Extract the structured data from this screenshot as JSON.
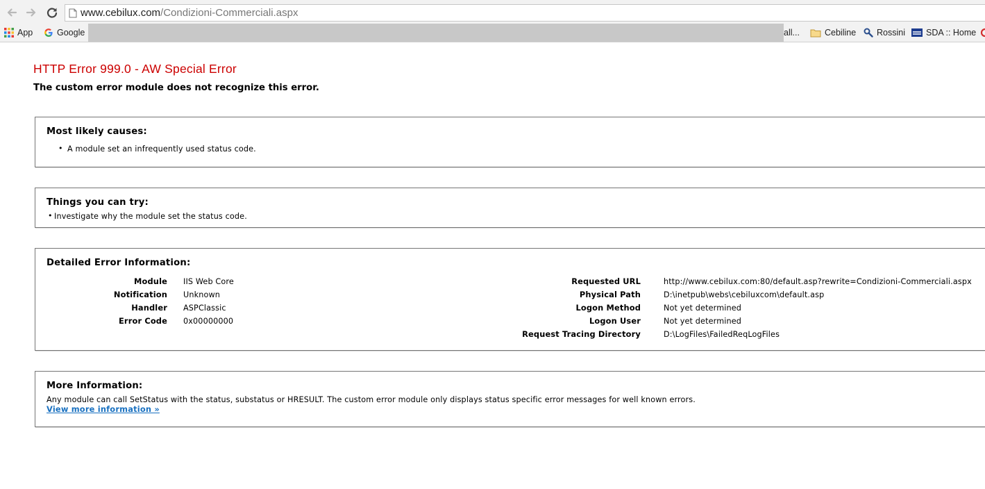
{
  "browser": {
    "url_host": "www.cebilux.com",
    "url_path": "/Condizioni-Commerciali.aspx",
    "bookmarks": [
      {
        "label": "App",
        "icon": "apps-grid-icon"
      },
      {
        "label": "Google",
        "icon": "google-icon"
      },
      {
        "label": "all...",
        "icon": ""
      },
      {
        "label": "Cebiline",
        "icon": "folder-icon"
      },
      {
        "label": "Rossini",
        "icon": "rossini-icon"
      },
      {
        "label": "SDA :: Home",
        "icon": "sda-icon"
      }
    ]
  },
  "error": {
    "title": "HTTP Error 999.0 - AW Special Error",
    "subtitle": "The custom error module does not recognize this error.",
    "causes": {
      "heading": "Most likely causes:",
      "items": [
        "A module set an infrequently used status code."
      ]
    },
    "try": {
      "heading": "Things you can try:",
      "items": [
        "Investigate why the module set the status code."
      ]
    },
    "detail": {
      "heading": "Detailed Error Information:",
      "left": [
        {
          "key": "Module",
          "value": "IIS Web Core"
        },
        {
          "key": "Notification",
          "value": "Unknown"
        },
        {
          "key": "Handler",
          "value": "ASPClassic"
        },
        {
          "key": "Error Code",
          "value": "0x00000000"
        }
      ],
      "right": [
        {
          "key": "Requested URL",
          "value": "http://www.cebilux.com:80/default.asp?rewrite=Condizioni-Commerciali.aspx"
        },
        {
          "key": "Physical Path",
          "value": "D:\\inetpub\\webs\\cebiluxcom\\default.asp"
        },
        {
          "key": "Logon Method",
          "value": "Not yet determined"
        },
        {
          "key": "Logon User",
          "value": "Not yet determined"
        },
        {
          "key": "Request Tracing Directory",
          "value": "D:\\LogFiles\\FailedReqLogFiles"
        }
      ]
    },
    "more": {
      "heading": "More Information:",
      "text": "Any module can call SetStatus with the status, substatus or HRESULT. The custom error module only displays status specific error messages for well known errors.",
      "link": "View more information »"
    }
  },
  "colors": {
    "title_red": "#cc0000",
    "link_blue": "#1870c0"
  }
}
